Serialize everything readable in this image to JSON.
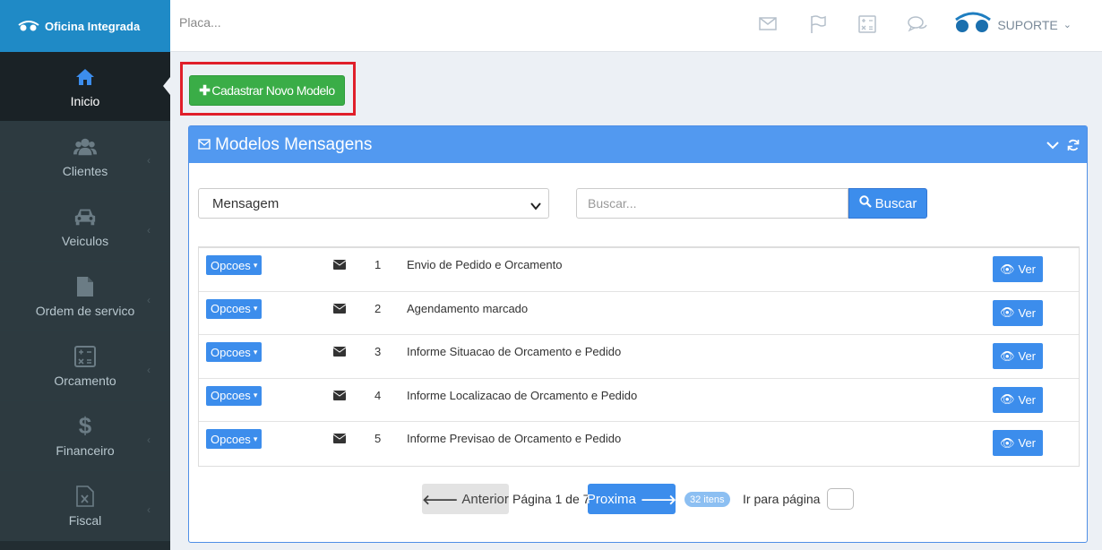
{
  "brand": {
    "name": "Oficina Integrada"
  },
  "sidebar": {
    "items": [
      {
        "label": "Inicio",
        "icon": "home-icon"
      },
      {
        "label": "Clientes",
        "icon": "users-icon"
      },
      {
        "label": "Veiculos",
        "icon": "car-icon"
      },
      {
        "label": "Ordem de servico",
        "icon": "file-icon"
      },
      {
        "label": "Orcamento",
        "icon": "calculator-icon"
      },
      {
        "label": "Financeiro",
        "icon": "dollar-icon"
      },
      {
        "label": "Fiscal",
        "icon": "excel-file-icon"
      }
    ]
  },
  "topbar": {
    "placeholder": "Placa...",
    "user": "SUPORTE"
  },
  "actions": {
    "add_label": "Cadastrar Novo Modelo"
  },
  "panel": {
    "title": "Modelos Mensagens",
    "filter_select": "Mensagem",
    "search_placeholder": "Buscar...",
    "search_label": "Buscar"
  },
  "table": {
    "rows": [
      {
        "options": "Opcoes",
        "num": "1",
        "message": "Envio de Pedido e Orcamento",
        "view": "Ver"
      },
      {
        "options": "Opcoes",
        "num": "2",
        "message": "Agendamento marcado",
        "view": "Ver"
      },
      {
        "options": "Opcoes",
        "num": "3",
        "message": "Informe Situacao de Orcamento e Pedido",
        "view": "Ver"
      },
      {
        "options": "Opcoes",
        "num": "4",
        "message": "Informe Localizacao de Orcamento e Pedido",
        "view": "Ver"
      },
      {
        "options": "Opcoes",
        "num": "5",
        "message": "Informe Previsao de Orcamento e Pedido",
        "view": "Ver"
      }
    ]
  },
  "pagination": {
    "prev": "Anterior",
    "info": "Página 1 de 7",
    "next": "Proxima",
    "count": "32 itens",
    "goto_label": "Ir para página"
  },
  "colors": {
    "brand": "#1f8ac6",
    "primary": "#3c8dec",
    "success": "#3aad47",
    "highlight": "#e01f2a"
  }
}
